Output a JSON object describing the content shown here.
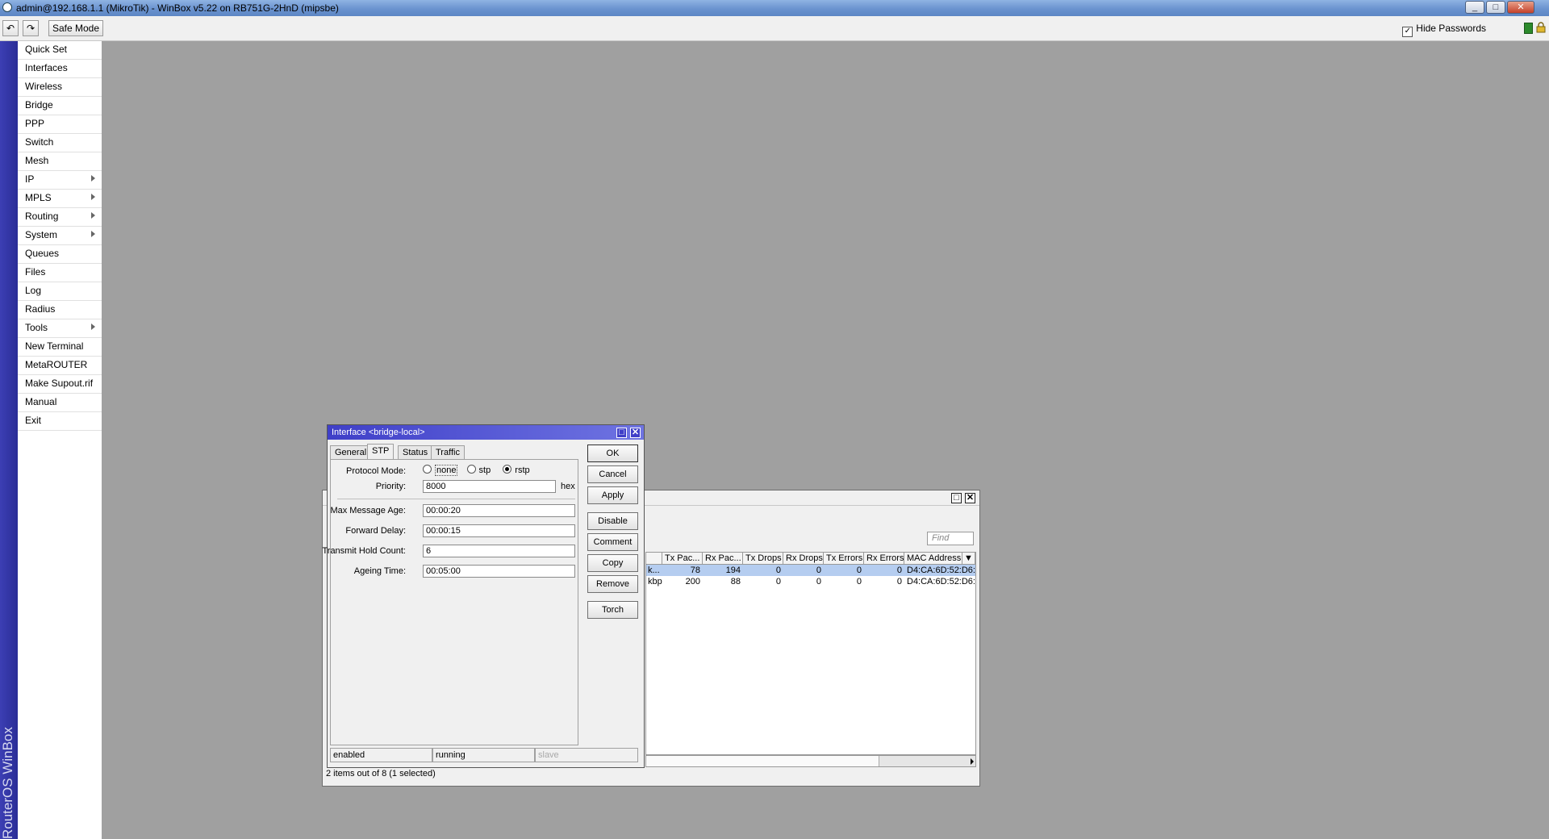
{
  "window": {
    "title": "admin@192.168.1.1 (MikroTik) - WinBox v5.22 on RB751G-2HnD (mipsbe)",
    "minimize_glyph": "_",
    "maximize_glyph": "□",
    "close_glyph": "✕"
  },
  "toolbar": {
    "undo_icon": "↶",
    "redo_icon": "↷",
    "safe_mode": "Safe Mode",
    "hide_passwords": "Hide Passwords",
    "hide_passwords_checked": "✓"
  },
  "side_label": "RouterOS WinBox",
  "menu": {
    "items": [
      {
        "label": "Quick Set",
        "submenu": false
      },
      {
        "label": "Interfaces",
        "submenu": false
      },
      {
        "label": "Wireless",
        "submenu": false
      },
      {
        "label": "Bridge",
        "submenu": false
      },
      {
        "label": "PPP",
        "submenu": false
      },
      {
        "label": "Switch",
        "submenu": false
      },
      {
        "label": "Mesh",
        "submenu": false
      },
      {
        "label": "IP",
        "submenu": true
      },
      {
        "label": "MPLS",
        "submenu": true
      },
      {
        "label": "Routing",
        "submenu": true
      },
      {
        "label": "System",
        "submenu": true
      },
      {
        "label": "Queues",
        "submenu": false
      },
      {
        "label": "Files",
        "submenu": false
      },
      {
        "label": "Log",
        "submenu": false
      },
      {
        "label": "Radius",
        "submenu": false
      },
      {
        "label": "Tools",
        "submenu": true
      },
      {
        "label": "New Terminal",
        "submenu": false
      },
      {
        "label": "MetaROUTER",
        "submenu": false
      },
      {
        "label": "Make Supout.rif",
        "submenu": false
      },
      {
        "label": "Manual",
        "submenu": false
      },
      {
        "label": "Exit",
        "submenu": false
      }
    ]
  },
  "interface_list": {
    "find_placeholder": "Find",
    "columns": [
      "Tx Pac...",
      "Rx Pac...",
      "Tx Drops",
      "Rx Drops",
      "Tx Errors",
      "Rx Errors",
      "MAC Address"
    ],
    "rows": [
      {
        "partial": "k...",
        "cells": [
          "78",
          "194",
          "0",
          "0",
          "0",
          "0",
          "D4:CA:6D:52:D6:/"
        ],
        "selected": true
      },
      {
        "partial": "kbps",
        "cells": [
          "200",
          "88",
          "0",
          "0",
          "0",
          "0",
          "D4:CA:6D:52:D6:/"
        ],
        "selected": false
      }
    ],
    "status": "2 items out of 8 (1 selected)",
    "restore_glyph": "□",
    "close_glyph": "✕",
    "dropdown_glyph": "▼"
  },
  "dialog": {
    "title": "Interface <bridge-local>",
    "restore_glyph": "□",
    "close_glyph": "✕",
    "tabs": [
      "General",
      "STP",
      "Status",
      "Traffic"
    ],
    "active_tab": "STP",
    "protocol_mode": {
      "label": "Protocol Mode:",
      "options": [
        "none",
        "stp",
        "rstp"
      ],
      "selected": "rstp"
    },
    "priority": {
      "label": "Priority:",
      "value": "8000",
      "suffix": "hex"
    },
    "max_message_age": {
      "label": "Max Message Age:",
      "value": "00:00:20"
    },
    "forward_delay": {
      "label": "Forward Delay:",
      "value": "00:00:15"
    },
    "transmit_hold_count": {
      "label": "Transmit Hold Count:",
      "value": "6"
    },
    "ageing_time": {
      "label": "Ageing Time:",
      "value": "00:05:00"
    },
    "buttons": {
      "ok": "OK",
      "cancel": "Cancel",
      "apply": "Apply",
      "disable": "Disable",
      "comment": "Comment",
      "copy": "Copy",
      "remove": "Remove",
      "torch": "Torch"
    },
    "status": {
      "enabled": "enabled",
      "running": "running",
      "slave": "slave"
    }
  },
  "colors": {
    "dialog_title": "#3f3fc8",
    "side_band": "#2a2d96",
    "workspace": "#a0a0a0",
    "selected_row": "#b5cdf0"
  }
}
